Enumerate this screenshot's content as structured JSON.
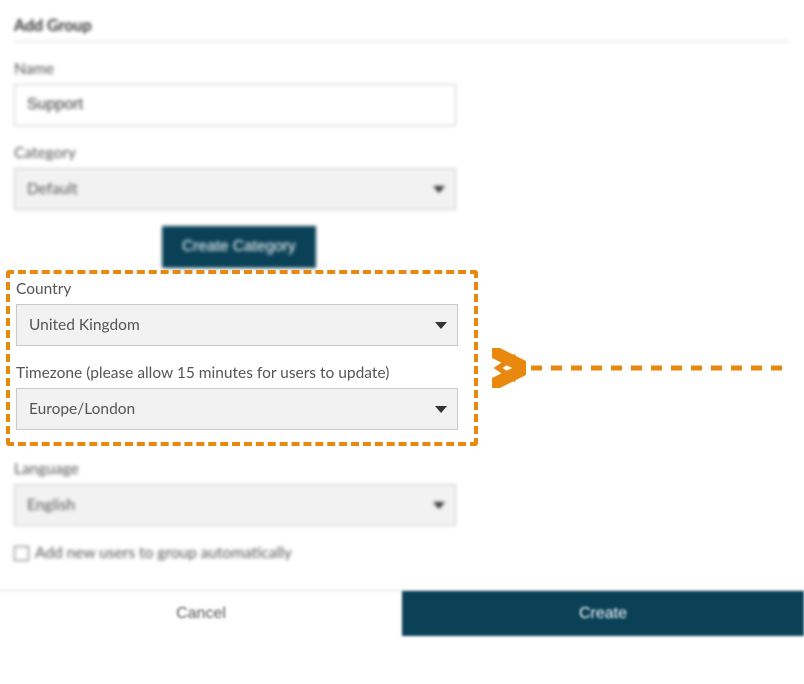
{
  "title": "Add Group",
  "name": {
    "label": "Name",
    "value": "Support"
  },
  "category": {
    "label": "Category",
    "value": "Default",
    "create_btn": "Create Category"
  },
  "country": {
    "label": "Country",
    "value": "United Kingdom"
  },
  "timezone": {
    "label": "Timezone (please allow 15 minutes for users to update)",
    "value": "Europe/London"
  },
  "language": {
    "label": "Language",
    "value": "English"
  },
  "auto_add": {
    "label": "Add new users to group automatically",
    "checked": false
  },
  "footer": {
    "cancel": "Cancel",
    "create": "Create"
  },
  "highlight_color": "#e8880f"
}
